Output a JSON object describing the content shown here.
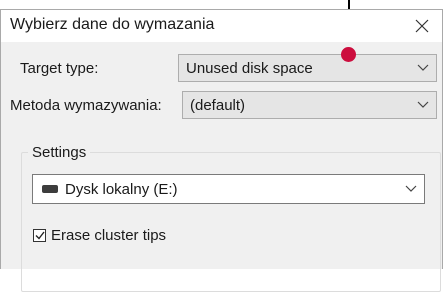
{
  "window": {
    "title": "Wybierz dane do wymazania"
  },
  "form": {
    "target_type_label": "Target type:",
    "target_type_value": "Unused disk space",
    "method_label": "Metoda wymazywania:",
    "method_value": "(default)"
  },
  "settings": {
    "group_label": "Settings",
    "drive_value": "Dysk lokalny (E:)",
    "erase_cluster_tips_label": "Erase cluster tips",
    "erase_cluster_tips_checked": true
  },
  "colors": {
    "marker": "#cc0e3e",
    "dialog_bg": "#f0f0f0",
    "combo_bg": "#e5e5e5"
  },
  "icons": {
    "close": "close-icon",
    "dropdown": "chevron-down-icon",
    "drive": "drive-icon",
    "check": "checkmark-icon"
  }
}
